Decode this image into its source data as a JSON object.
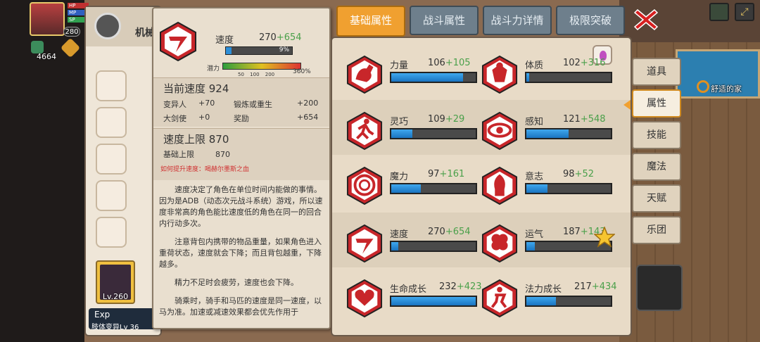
{
  "hud": {
    "level": "280",
    "gems": "4664",
    "bar_labels": [
      "HP",
      "MP",
      "SP"
    ]
  },
  "char_panel": {
    "name": "机械",
    "hero_level": "Lv.260",
    "exp_label": "Exp",
    "exp_sub": "肢体变异Lv 36"
  },
  "tooltip": {
    "stat_name": "速度",
    "stat_value": "270",
    "stat_bonus": "+654",
    "bar_pct_label": "9%",
    "bar_fraction": 0.09,
    "potential_label": "潜力",
    "potential_ticks": [
      "50",
      "100",
      "200"
    ],
    "potential_pct": "360%",
    "current": {
      "title": "当前速度 924",
      "rows": [
        [
          "变异人",
          "+70",
          "锻炼或重生",
          "+200"
        ],
        [
          "大剑使",
          "+0",
          "奖励",
          "+654"
        ]
      ]
    },
    "cap": {
      "title": "速度上限 870",
      "base_label": "基础上限",
      "base_value": "870"
    },
    "howto": "如何提升速度：喝赫尔墨斯之血",
    "desc": [
      "速度决定了角色在单位时间内能做的事情。因为是ADB（动态次元战斗系统）游戏，所以速度非常高的角色能比速度低的角色在同一的回合内行动多次。",
      "注意背包内携带的物品重量，如果角色进入重荷状态，速度就会下降；而且背包越重，下降越多。",
      "精力不足时会疲劳，速度也会下降。",
      "骑乘时，骑手和马匹的速度是同一速度，以马为准。加速或减速效果都会优先作用于"
    ]
  },
  "tabs": [
    {
      "label": "基础属性",
      "active": true
    },
    {
      "label": "战斗属性",
      "active": false
    },
    {
      "label": "战斗力详情",
      "active": false
    },
    {
      "label": "极限突破",
      "active": false
    }
  ],
  "attributes": [
    {
      "icon": "strength-icon",
      "name": "力量",
      "base": "106",
      "bonus": "+105",
      "fill": 0.85
    },
    {
      "icon": "constitution-icon",
      "name": "体质",
      "base": "102",
      "bonus": "+316",
      "fill": 0.03
    },
    {
      "icon": "agility-icon",
      "name": "灵巧",
      "base": "109",
      "bonus": "+29",
      "fill": 0.25
    },
    {
      "icon": "perception-icon",
      "name": "感知",
      "base": "121",
      "bonus": "+548",
      "fill": 0.5
    },
    {
      "icon": "magic-icon",
      "name": "魔力",
      "base": "97",
      "bonus": "+161",
      "fill": 0.35
    },
    {
      "icon": "will-icon",
      "name": "意志",
      "base": "98",
      "bonus": "+52",
      "fill": 0.25
    },
    {
      "icon": "speed-icon",
      "name": "速度",
      "base": "270",
      "bonus": "+654",
      "fill": 0.08
    },
    {
      "icon": "luck-icon",
      "name": "运气",
      "base": "187",
      "bonus": "+143",
      "fill": 0.1
    },
    {
      "icon": "life-growth-icon",
      "name": "生命成长",
      "base": "232",
      "bonus": "+423",
      "fill": 1.0
    },
    {
      "icon": "mana-growth-icon",
      "name": "法力成长",
      "base": "217",
      "bonus": "+434",
      "fill": 0.35
    }
  ],
  "side_menu": [
    {
      "label": "道具",
      "active": false
    },
    {
      "label": "属性",
      "active": true
    },
    {
      "label": "技能",
      "active": false
    },
    {
      "label": "魔法",
      "active": false
    },
    {
      "label": "天赋",
      "active": false
    },
    {
      "label": "乐团",
      "active": false
    }
  ],
  "room_label": "舒适的家",
  "colors": {
    "tab_active": "#f0a030",
    "bar_fill": "#2d8fd8",
    "bonus": "#4aa04a",
    "icon_red": "#c8262a"
  }
}
